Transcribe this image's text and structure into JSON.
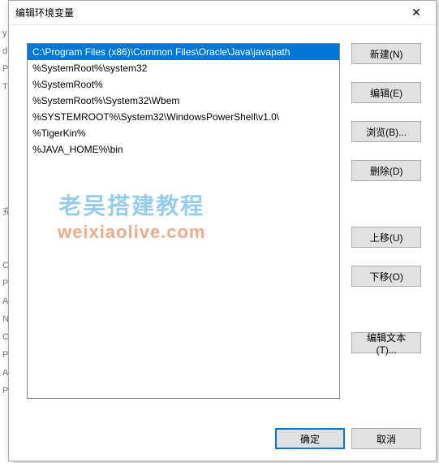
{
  "title": "编辑环境变量",
  "bg_letters": [
    "y",
    "d",
    "P",
    "T",
    "",
    "",
    "",
    "",
    "",
    "",
    "充",
    "",
    "",
    "C",
    "P",
    "A",
    "N",
    "O",
    "P",
    "A",
    "P"
  ],
  "list": {
    "items": [
      "C:\\Program Files (x86)\\Common Files\\Oracle\\Java\\javapath",
      "%SystemRoot%\\system32",
      "%SystemRoot%",
      "%SystemRoot%\\System32\\Wbem",
      "%SYSTEMROOT%\\System32\\WindowsPowerShell\\v1.0\\",
      "%TigerKin%",
      "%JAVA_HOME%\\bin"
    ],
    "selected_index": 0
  },
  "buttons": {
    "new": "新建(N)",
    "edit": "编辑(E)",
    "browse": "浏览(B)...",
    "delete": "删除(D)",
    "move_up": "上移(U)",
    "move_down": "下移(O)",
    "edit_text": "编辑文本(T)...",
    "ok": "确定",
    "cancel": "取消"
  },
  "watermark": {
    "line1": "老吴搭建教程",
    "line2": "weixiaolive.com"
  }
}
